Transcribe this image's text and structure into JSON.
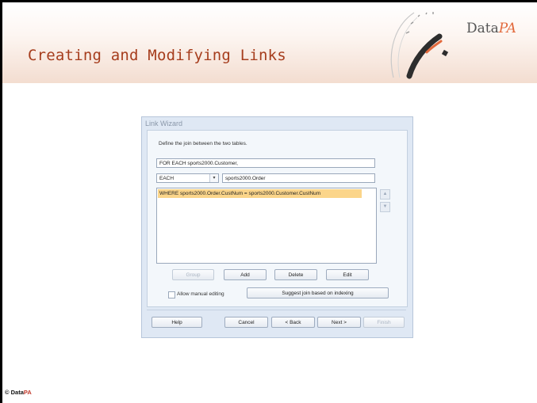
{
  "slide": {
    "title": "Creating and Modifying Links",
    "brand_data": "Data",
    "brand_pa": "PA",
    "footer_copy": "© Data",
    "footer_pa": "PA"
  },
  "wizard": {
    "title": "Link Wizard",
    "instruction": "Define the join between the two tables.",
    "for_each_value": "FOR EACH sports2000.Customer,",
    "each_select_value": "EACH",
    "table_value": "sports2000.Order",
    "where_clause": "WHERE sports2000.Order.CustNum = sports2000.Customer.CustNum",
    "buttons": {
      "group": "Group",
      "add": "Add",
      "delete": "Delete",
      "edit": "Edit",
      "suggest": "Suggest join based on indexing",
      "help": "Help",
      "cancel": "Cancel",
      "back": "< Back",
      "next": "Next >",
      "finish": "Finish"
    },
    "allow_manual_label": "Allow manual editing",
    "allow_manual_checked": false
  },
  "icons": {
    "up": "move-up-icon",
    "down": "move-down-icon",
    "dropdown": "chevron-down-icon",
    "logo": "datapa-gauge-logo"
  },
  "colors": {
    "title": "#a63d1d",
    "brand_accent": "#e2693c",
    "selection": "#fbd58a",
    "dialog_bg": "#dfe8f4"
  }
}
